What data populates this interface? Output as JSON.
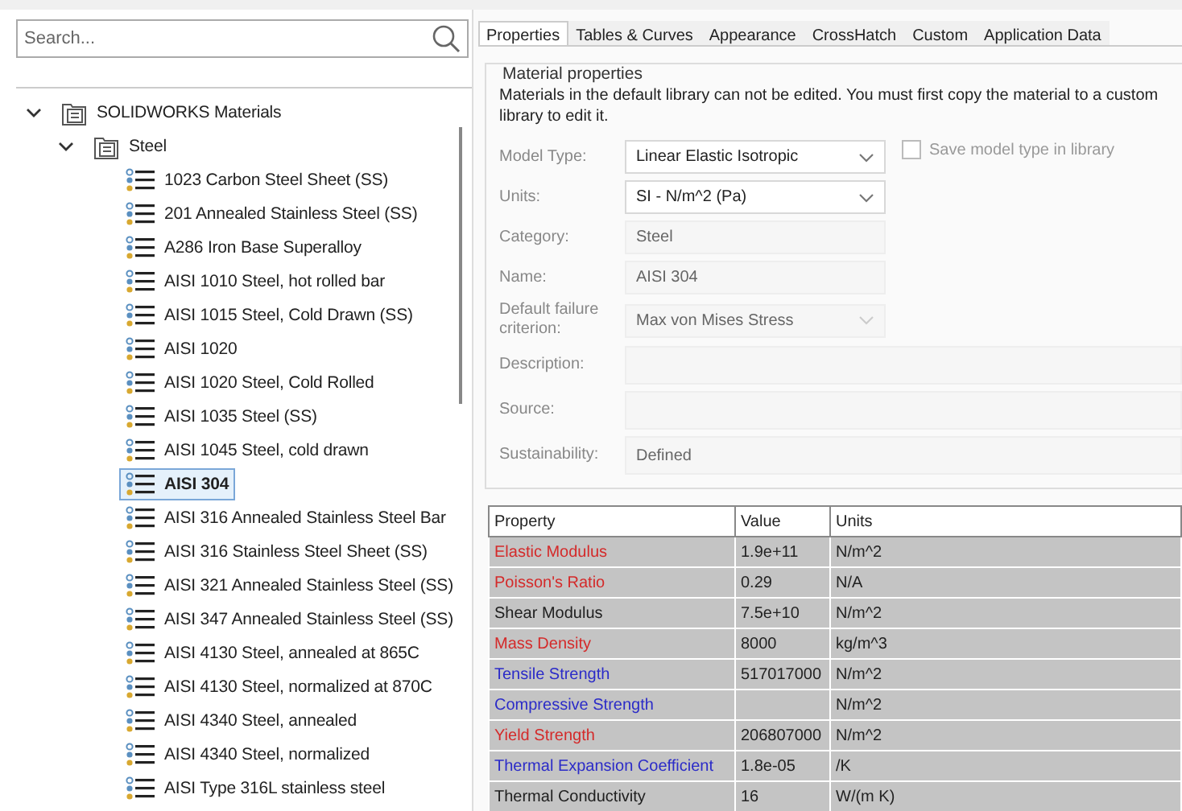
{
  "search": {
    "placeholder": "Search..."
  },
  "tree": [
    {
      "label": "SOLIDWORKS Materials",
      "kind": "library",
      "expanded": true,
      "children": [
        {
          "label": "Steel",
          "kind": "folder",
          "expanded": true,
          "children": [
            {
              "label": "1023 Carbon Steel Sheet (SS)",
              "kind": "material",
              "selected": false
            },
            {
              "label": "201 Annealed Stainless Steel (SS)",
              "kind": "material",
              "selected": false
            },
            {
              "label": "A286 Iron Base Superalloy",
              "kind": "material",
              "selected": false
            },
            {
              "label": "AISI 1010 Steel, hot rolled bar",
              "kind": "material",
              "selected": false
            },
            {
              "label": "AISI 1015 Steel, Cold Drawn (SS)",
              "kind": "material",
              "selected": false
            },
            {
              "label": "AISI 1020",
              "kind": "material",
              "selected": false
            },
            {
              "label": "AISI 1020 Steel, Cold Rolled",
              "kind": "material",
              "selected": false
            },
            {
              "label": "AISI 1035 Steel (SS)",
              "kind": "material",
              "selected": false
            },
            {
              "label": "AISI 1045 Steel, cold drawn",
              "kind": "material",
              "selected": false
            },
            {
              "label": "AISI 304",
              "kind": "material",
              "selected": true
            },
            {
              "label": "AISI 316 Annealed Stainless Steel Bar",
              "kind": "material",
              "selected": false
            },
            {
              "label": "AISI 316 Stainless Steel Sheet (SS)",
              "kind": "material",
              "selected": false
            },
            {
              "label": "AISI 321 Annealed Stainless Steel (SS)",
              "kind": "material",
              "selected": false
            },
            {
              "label": "AISI 347 Annealed Stainless Steel (SS)",
              "kind": "material",
              "selected": false
            },
            {
              "label": "AISI 4130 Steel, annealed at 865C",
              "kind": "material",
              "selected": false
            },
            {
              "label": "AISI 4130 Steel, normalized at 870C",
              "kind": "material",
              "selected": false
            },
            {
              "label": "AISI 4340 Steel, annealed",
              "kind": "material",
              "selected": false
            },
            {
              "label": "AISI 4340 Steel, normalized",
              "kind": "material",
              "selected": false
            },
            {
              "label": "AISI Type 316L stainless steel",
              "kind": "material",
              "selected": false
            }
          ]
        }
      ]
    }
  ],
  "tabs": [
    {
      "label": "Properties",
      "selected": true
    },
    {
      "label": "Tables & Curves",
      "selected": false
    },
    {
      "label": "Appearance",
      "selected": false
    },
    {
      "label": "CrossHatch",
      "selected": false
    },
    {
      "label": "Custom",
      "selected": false
    },
    {
      "label": "Application Data",
      "selected": false
    }
  ],
  "material_properties": {
    "title": "Material properties",
    "note": "Materials in the default library can not be edited. You must first copy the material to a custom library to edit it.",
    "fields": [
      {
        "label": "Model Type:",
        "kind": "dropdown",
        "value": "Linear Elastic Isotropic",
        "disabled": false
      },
      {
        "label": "Units:",
        "kind": "dropdown",
        "value": "SI - N/m^2 (Pa)",
        "disabled": false
      },
      {
        "label": "Category:",
        "kind": "text",
        "value": "Steel",
        "disabled": true
      },
      {
        "label": "Name:",
        "kind": "text",
        "value": "AISI 304",
        "disabled": true
      },
      {
        "label": "Default failure criterion:",
        "kind": "dropdown",
        "value": "Max von Mises Stress",
        "disabled": true
      },
      {
        "label": "Description:",
        "kind": "wide",
        "disabled": true
      },
      {
        "label": "Source:",
        "kind": "wide",
        "disabled": true
      },
      {
        "label": "Sustainability:",
        "kind": "wide",
        "value": "Defined",
        "disabled": true
      }
    ],
    "save_model_type": {
      "label": "Save model type in library",
      "checked": false
    }
  },
  "table": {
    "columns": [
      "Property",
      "Value",
      "Units"
    ],
    "rows": [
      {
        "property": "Elastic Modulus",
        "value": "1.9e+11",
        "units": "N/m^2",
        "color": "#d42a2a"
      },
      {
        "property": "Poisson's Ratio",
        "value": "0.29",
        "units": "N/A",
        "color": "#d42a2a"
      },
      {
        "property": "Shear Modulus",
        "value": "7.5e+10",
        "units": "N/m^2",
        "color": "#202020"
      },
      {
        "property": "Mass Density",
        "value": "8000",
        "units": "kg/m^3",
        "color": "#d42a2a"
      },
      {
        "property": "Tensile Strength",
        "value": "517017000",
        "units": "N/m^2",
        "color": "#2b2bc8"
      },
      {
        "property": "Compressive Strength",
        "units": "N/m^2",
        "color": "#2b2bc8"
      },
      {
        "property": "Yield Strength",
        "value": "206807000",
        "units": "N/m^2",
        "color": "#d42a2a"
      },
      {
        "property": "Thermal Expansion Coefficient",
        "value": "1.8e-05",
        "units": "/K",
        "color": "#2b2bc8"
      },
      {
        "property": "Thermal Conductivity",
        "value": "16",
        "units": "W/(m K)",
        "color": "#202020"
      }
    ]
  }
}
